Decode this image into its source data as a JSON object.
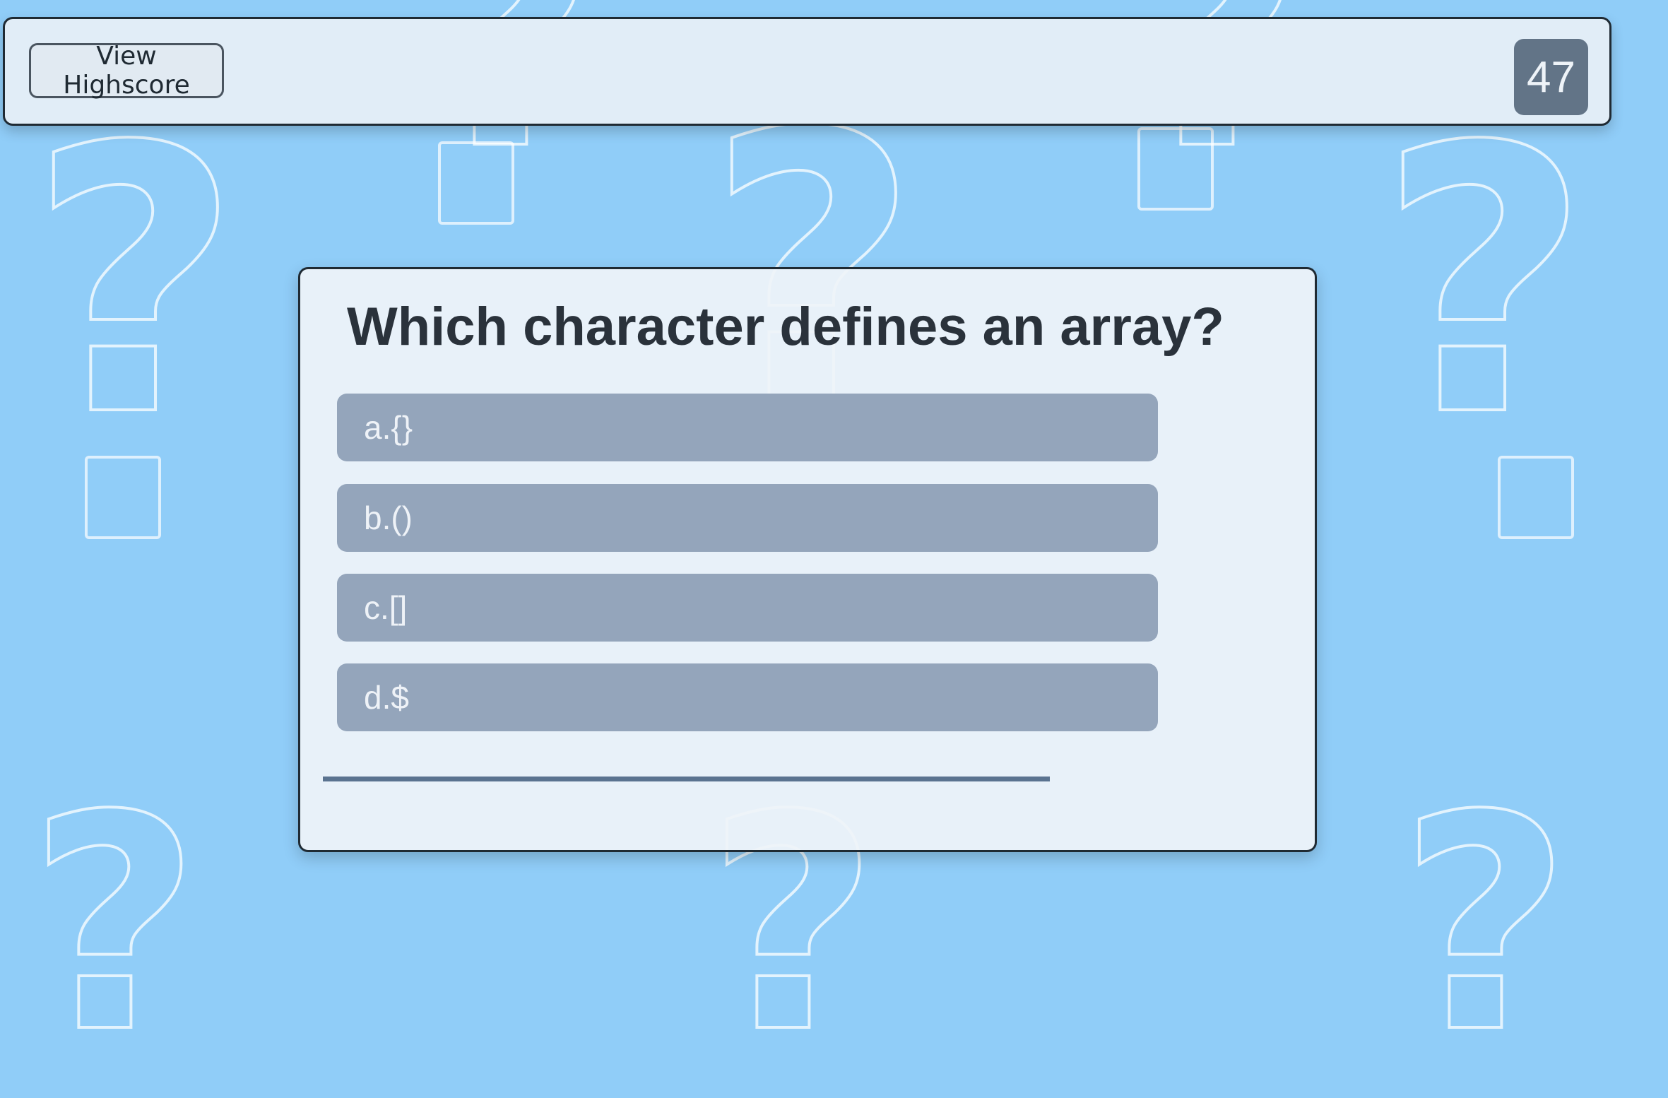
{
  "header": {
    "highscore_label": "View Highscore",
    "timer": "47"
  },
  "quiz": {
    "question": "Which character defines an array?",
    "options": [
      {
        "label": "a.{}"
      },
      {
        "label": "b.()"
      },
      {
        "label": "c.[]"
      },
      {
        "label": "d.$"
      }
    ],
    "progress_fraction": 0.73
  },
  "colors": {
    "background": "#90cdf8",
    "option": "#94a5bb",
    "timer_bg": "#627487",
    "progress": "#5a7390"
  }
}
